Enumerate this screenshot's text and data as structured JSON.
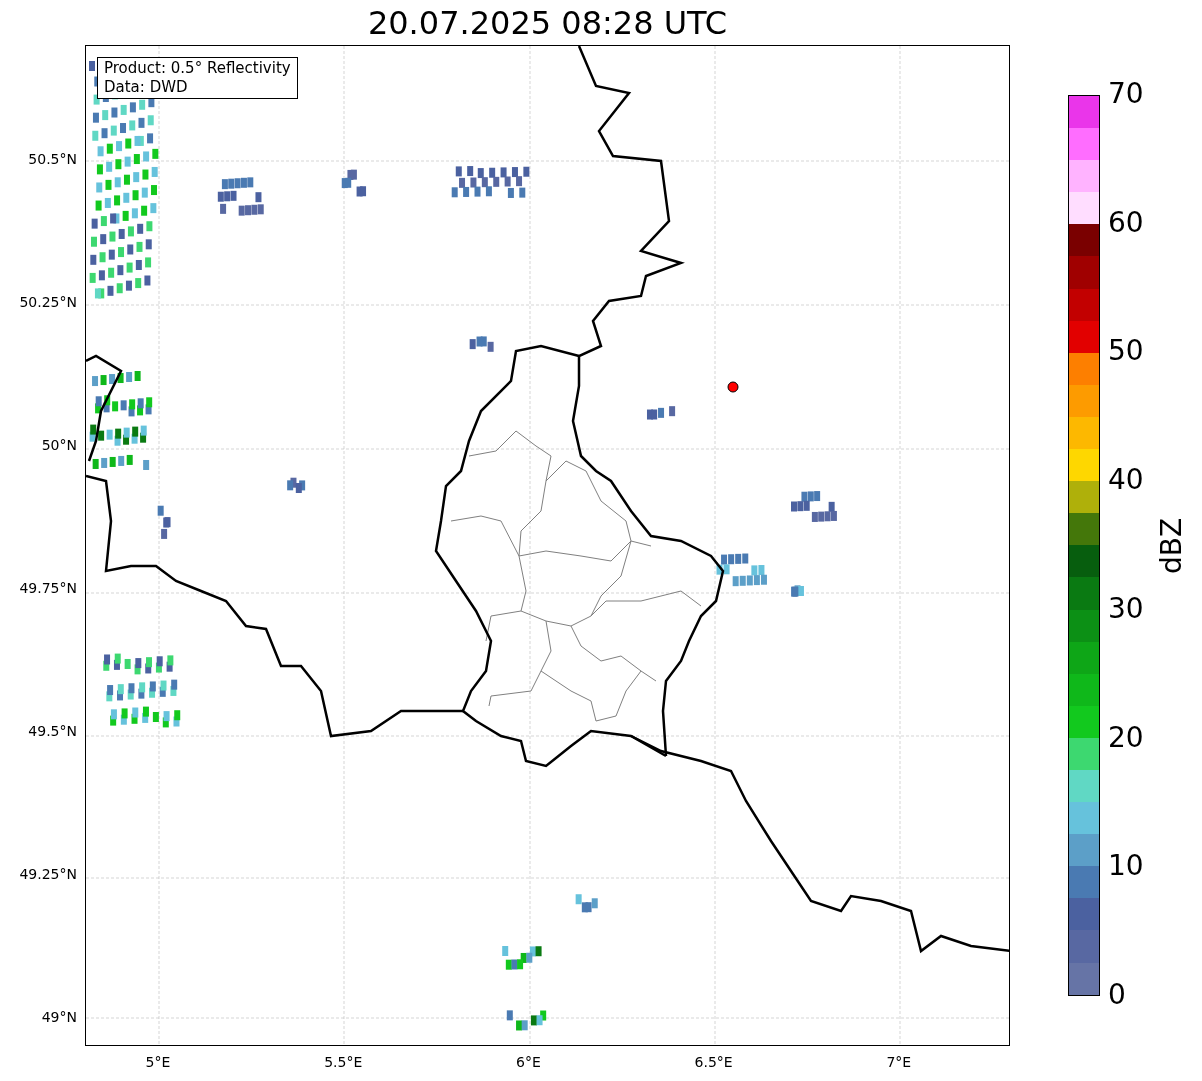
{
  "title": "20.07.2025 08:28 UTC",
  "info_box": [
    "Product: 0.5° Reflectivity",
    "Data: DWD"
  ],
  "y_ticks": [
    "50.5°N",
    "50.25°N",
    "50°N",
    "49.75°N",
    "49.5°N",
    "49.25°N",
    "49°N"
  ],
  "x_ticks": [
    "5°E",
    "5.5°E",
    "6°E",
    "6.5°E",
    "7°E"
  ],
  "colorbar": {
    "label": "dBZ",
    "ticks": [
      "70",
      "60",
      "50",
      "40",
      "30",
      "20",
      "10",
      "0"
    ],
    "segments": [
      {
        "color": "#ea35ea"
      },
      {
        "color": "#ff6dff"
      },
      {
        "color": "#ffb3ff"
      },
      {
        "color": "#ffddff"
      },
      {
        "color": "#7a0000"
      },
      {
        "color": "#a00000"
      },
      {
        "color": "#c20000"
      },
      {
        "color": "#e20000"
      },
      {
        "color": "#fd7f00"
      },
      {
        "color": "#fd9b00"
      },
      {
        "color": "#fdb800"
      },
      {
        "color": "#fed700"
      },
      {
        "color": "#afb00a"
      },
      {
        "color": "#44770a"
      },
      {
        "color": "#075e0e"
      },
      {
        "color": "#0a7a12"
      },
      {
        "color": "#0c9015"
      },
      {
        "color": "#0ea617"
      },
      {
        "color": "#0fb81a"
      },
      {
        "color": "#12c91e"
      },
      {
        "color": "#3dd870"
      },
      {
        "color": "#60d8c4"
      },
      {
        "color": "#66c2dc"
      },
      {
        "color": "#5c9fc8"
      },
      {
        "color": "#4a7ab2"
      },
      {
        "color": "#4b61a0"
      },
      {
        "color": "#5868a2"
      },
      {
        "color": "#6674a6"
      }
    ]
  }
}
